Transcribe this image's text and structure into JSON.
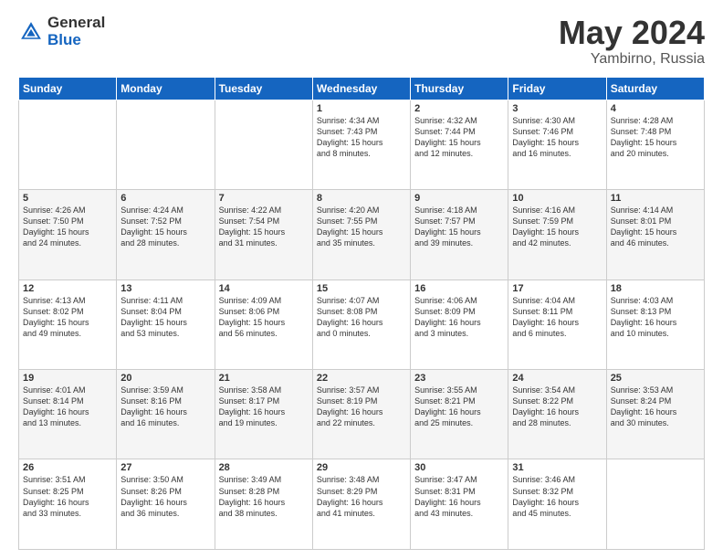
{
  "header": {
    "logo_general": "General",
    "logo_blue": "Blue",
    "title": "May 2024",
    "location": "Yambirno, Russia"
  },
  "weekdays": [
    "Sunday",
    "Monday",
    "Tuesday",
    "Wednesday",
    "Thursday",
    "Friday",
    "Saturday"
  ],
  "weeks": [
    [
      {
        "day": "",
        "info": ""
      },
      {
        "day": "",
        "info": ""
      },
      {
        "day": "",
        "info": ""
      },
      {
        "day": "1",
        "info": "Sunrise: 4:34 AM\nSunset: 7:43 PM\nDaylight: 15 hours\nand 8 minutes."
      },
      {
        "day": "2",
        "info": "Sunrise: 4:32 AM\nSunset: 7:44 PM\nDaylight: 15 hours\nand 12 minutes."
      },
      {
        "day": "3",
        "info": "Sunrise: 4:30 AM\nSunset: 7:46 PM\nDaylight: 15 hours\nand 16 minutes."
      },
      {
        "day": "4",
        "info": "Sunrise: 4:28 AM\nSunset: 7:48 PM\nDaylight: 15 hours\nand 20 minutes."
      }
    ],
    [
      {
        "day": "5",
        "info": "Sunrise: 4:26 AM\nSunset: 7:50 PM\nDaylight: 15 hours\nand 24 minutes."
      },
      {
        "day": "6",
        "info": "Sunrise: 4:24 AM\nSunset: 7:52 PM\nDaylight: 15 hours\nand 28 minutes."
      },
      {
        "day": "7",
        "info": "Sunrise: 4:22 AM\nSunset: 7:54 PM\nDaylight: 15 hours\nand 31 minutes."
      },
      {
        "day": "8",
        "info": "Sunrise: 4:20 AM\nSunset: 7:55 PM\nDaylight: 15 hours\nand 35 minutes."
      },
      {
        "day": "9",
        "info": "Sunrise: 4:18 AM\nSunset: 7:57 PM\nDaylight: 15 hours\nand 39 minutes."
      },
      {
        "day": "10",
        "info": "Sunrise: 4:16 AM\nSunset: 7:59 PM\nDaylight: 15 hours\nand 42 minutes."
      },
      {
        "day": "11",
        "info": "Sunrise: 4:14 AM\nSunset: 8:01 PM\nDaylight: 15 hours\nand 46 minutes."
      }
    ],
    [
      {
        "day": "12",
        "info": "Sunrise: 4:13 AM\nSunset: 8:02 PM\nDaylight: 15 hours\nand 49 minutes."
      },
      {
        "day": "13",
        "info": "Sunrise: 4:11 AM\nSunset: 8:04 PM\nDaylight: 15 hours\nand 53 minutes."
      },
      {
        "day": "14",
        "info": "Sunrise: 4:09 AM\nSunset: 8:06 PM\nDaylight: 15 hours\nand 56 minutes."
      },
      {
        "day": "15",
        "info": "Sunrise: 4:07 AM\nSunset: 8:08 PM\nDaylight: 16 hours\nand 0 minutes."
      },
      {
        "day": "16",
        "info": "Sunrise: 4:06 AM\nSunset: 8:09 PM\nDaylight: 16 hours\nand 3 minutes."
      },
      {
        "day": "17",
        "info": "Sunrise: 4:04 AM\nSunset: 8:11 PM\nDaylight: 16 hours\nand 6 minutes."
      },
      {
        "day": "18",
        "info": "Sunrise: 4:03 AM\nSunset: 8:13 PM\nDaylight: 16 hours\nand 10 minutes."
      }
    ],
    [
      {
        "day": "19",
        "info": "Sunrise: 4:01 AM\nSunset: 8:14 PM\nDaylight: 16 hours\nand 13 minutes."
      },
      {
        "day": "20",
        "info": "Sunrise: 3:59 AM\nSunset: 8:16 PM\nDaylight: 16 hours\nand 16 minutes."
      },
      {
        "day": "21",
        "info": "Sunrise: 3:58 AM\nSunset: 8:17 PM\nDaylight: 16 hours\nand 19 minutes."
      },
      {
        "day": "22",
        "info": "Sunrise: 3:57 AM\nSunset: 8:19 PM\nDaylight: 16 hours\nand 22 minutes."
      },
      {
        "day": "23",
        "info": "Sunrise: 3:55 AM\nSunset: 8:21 PM\nDaylight: 16 hours\nand 25 minutes."
      },
      {
        "day": "24",
        "info": "Sunrise: 3:54 AM\nSunset: 8:22 PM\nDaylight: 16 hours\nand 28 minutes."
      },
      {
        "day": "25",
        "info": "Sunrise: 3:53 AM\nSunset: 8:24 PM\nDaylight: 16 hours\nand 30 minutes."
      }
    ],
    [
      {
        "day": "26",
        "info": "Sunrise: 3:51 AM\nSunset: 8:25 PM\nDaylight: 16 hours\nand 33 minutes."
      },
      {
        "day": "27",
        "info": "Sunrise: 3:50 AM\nSunset: 8:26 PM\nDaylight: 16 hours\nand 36 minutes."
      },
      {
        "day": "28",
        "info": "Sunrise: 3:49 AM\nSunset: 8:28 PM\nDaylight: 16 hours\nand 38 minutes."
      },
      {
        "day": "29",
        "info": "Sunrise: 3:48 AM\nSunset: 8:29 PM\nDaylight: 16 hours\nand 41 minutes."
      },
      {
        "day": "30",
        "info": "Sunrise: 3:47 AM\nSunset: 8:31 PM\nDaylight: 16 hours\nand 43 minutes."
      },
      {
        "day": "31",
        "info": "Sunrise: 3:46 AM\nSunset: 8:32 PM\nDaylight: 16 hours\nand 45 minutes."
      },
      {
        "day": "",
        "info": ""
      }
    ]
  ]
}
